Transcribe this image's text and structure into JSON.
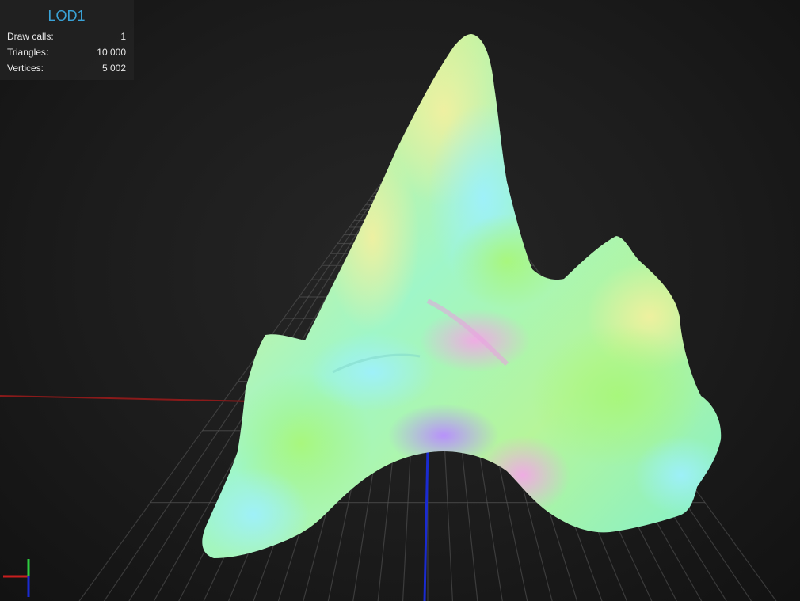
{
  "stats": {
    "lod_label": "LOD1",
    "rows": [
      {
        "label": "Draw calls:",
        "value": "1"
      },
      {
        "label": "Triangles:",
        "value": "10 000"
      },
      {
        "label": "Vertices:",
        "value": "5 002"
      }
    ]
  },
  "scene": {
    "object": "shark-tooth-mesh",
    "shading": "normal-map",
    "grid": true
  },
  "colors": {
    "background": "#1a1a1a",
    "panel_bg": "#222222",
    "lod_title": "#3aa3d8",
    "axis_x": "#c81e1e",
    "axis_y": "#2ecc40",
    "axis_z": "#1a2bd0",
    "grid_line": "#5a5a5a"
  },
  "icons": {
    "axis_gizmo": "axis-gizmo-icon"
  }
}
